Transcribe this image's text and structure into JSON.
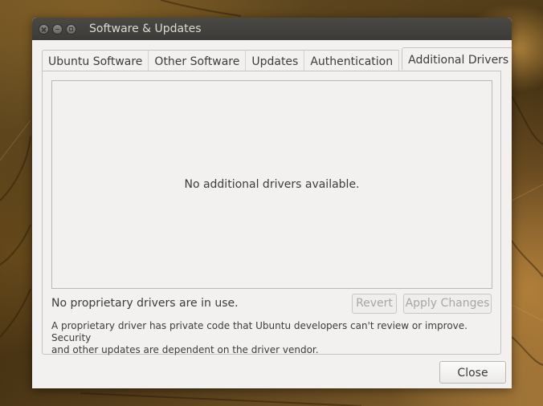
{
  "window": {
    "title": "Software & Updates"
  },
  "tabs": [
    {
      "label": "Ubuntu Software",
      "active": false
    },
    {
      "label": "Other Software",
      "active": false
    },
    {
      "label": "Updates",
      "active": false
    },
    {
      "label": "Authentication",
      "active": false
    },
    {
      "label": "Additional Drivers",
      "active": true
    }
  ],
  "drivers": {
    "empty_message": "No additional drivers available.",
    "status": "No proprietary drivers are in use.",
    "revert_label": "Revert",
    "apply_label": "Apply Changes",
    "explanation_line1": "A proprietary driver has private code that Ubuntu developers can't review or improve. Security",
    "explanation_line2": "and other updates are dependent on the driver vendor."
  },
  "footer": {
    "close_label": "Close"
  },
  "colors": {
    "titlebar": "#3c3b37",
    "window_bg": "#f2f1f0",
    "text": "#3c3c3c",
    "disabled_text": "#a8a6a2"
  }
}
